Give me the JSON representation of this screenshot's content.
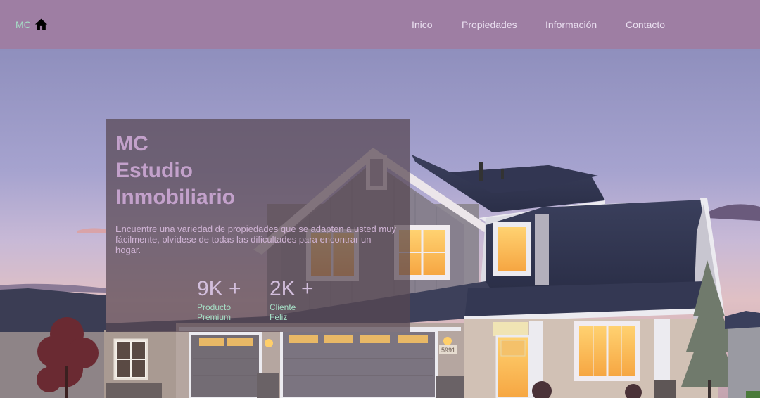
{
  "navbar": {
    "brand": "MC",
    "brand_icon": "home-icon",
    "links": [
      "Inico",
      "Propiedades",
      "Información",
      "Contacto"
    ]
  },
  "hero": {
    "image": "house-photo",
    "house_number": "5991",
    "title_lines": [
      "MC",
      "Estudio",
      "Inmobiliario"
    ],
    "description": "Encuentre una variedad de propiedades que se adapten a usted muy fácilmente, olvídese de todas las dificultades para encontrar un hogar.",
    "stats": [
      {
        "value": "9K +",
        "label_lines": [
          "Producto",
          "Premium"
        ]
      },
      {
        "value": "2K +",
        "label_lines": [
          "Cliente",
          "Feliz"
        ]
      }
    ]
  },
  "colors": {
    "navbar_bg": "#9e7ea3",
    "brand_text": "#a6dfc6",
    "title": "#c3a1cb",
    "stat_label": "#a6dfc6"
  }
}
